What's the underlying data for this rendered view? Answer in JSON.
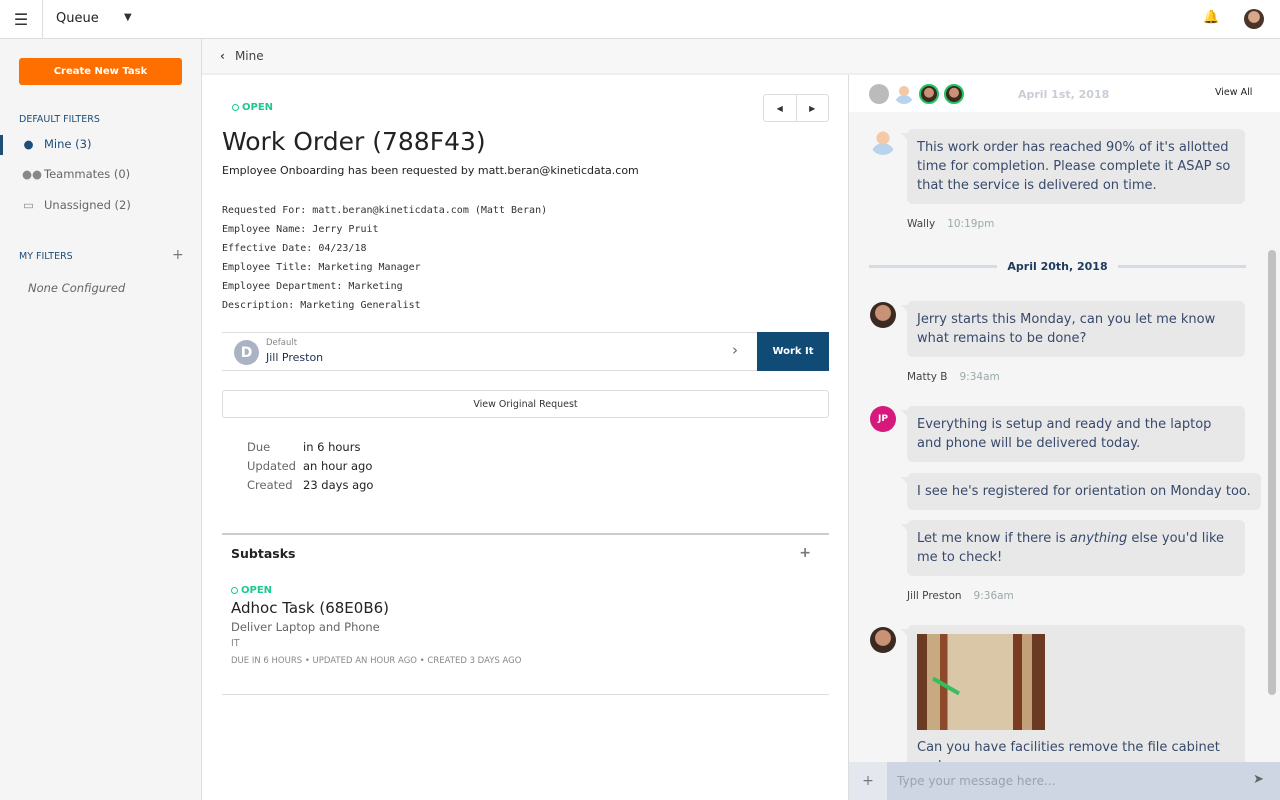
{
  "topbar": {
    "menu_icon": "hamburger-icon",
    "title": "Queue",
    "notify_icon": "bell-icon"
  },
  "sidebar": {
    "create_label": "Create New Task",
    "default_filters_heading": "DEFAULT FILTERS",
    "filters": [
      {
        "label": "Mine (3)",
        "icon": "user-icon",
        "active": true
      },
      {
        "label": "Teammates (0)",
        "icon": "users-icon"
      },
      {
        "label": "Unassigned (2)",
        "icon": "inbox-icon"
      }
    ],
    "my_filters_heading": "MY FILTERS",
    "my_filters_empty": "None Configured"
  },
  "breadcrumb": {
    "label": "Mine"
  },
  "task": {
    "status": "OPEN",
    "title": "Work Order (788F43)",
    "subtitle": "Employee Onboarding has been requested by matt.beran@kineticdata.com",
    "fields": [
      "Requested For: matt.beran@kineticdata.com (Matt Beran)",
      "Employee Name: Jerry Pruit",
      "Effective Date: 04/23/18",
      "Employee Title: Marketing Manager",
      "Employee Department: Marketing",
      "Description: Marketing Generalist"
    ],
    "assignment": {
      "initial": "D",
      "team": "Default",
      "assignee": "Jill Preston",
      "work_label": "Work It"
    },
    "view_original_label": "View Original Request",
    "meta": [
      {
        "label": "Due",
        "value": "in 6 hours"
      },
      {
        "label": "Updated",
        "value": "an hour ago"
      },
      {
        "label": "Created",
        "value": "23 days ago"
      }
    ]
  },
  "subtasks": {
    "heading": "Subtasks",
    "items": [
      {
        "status": "OPEN",
        "title": "Adhoc Task (68E0B6)",
        "description": "Deliver Laptop and Phone",
        "team": "IT",
        "meta": "DUE IN 6 HOURS • UPDATED AN HOUR AGO • CREATED 3 DAYS AGO"
      }
    ]
  },
  "chat": {
    "header_date": "April 1st, 2018",
    "view_all": "View All",
    "msgs": [
      {
        "author": "Wally",
        "time": "10:19pm",
        "text": "This work order has reached 90% of it's allotted time for completion. Please complete it ASAP so that the service is delivered on time."
      },
      {
        "date": "April 20th, 2018"
      },
      {
        "author": "Matty B",
        "time": "9:34am",
        "text": "Jerry starts this Monday, can you let me know what remains to be done?"
      },
      {
        "author": "Jill Preston",
        "initials": "JP",
        "time": "9:36am",
        "texts": [
          "Everything is setup and ready and the laptop and phone will be delivered today.",
          "I see he's registered for orientation on Monday too.",
          "Let me know if there is ",
          "anything",
          " else you'd like me to check!"
        ]
      },
      {
        "text": "Can you have facilities remove the file cabinet and"
      }
    ],
    "input_placeholder": "Type your message here...",
    "colors": {
      "accent": "#ff6f00",
      "primary": "#0f4b74",
      "open": "#1ec98f",
      "jp": "#d6197a"
    }
  }
}
